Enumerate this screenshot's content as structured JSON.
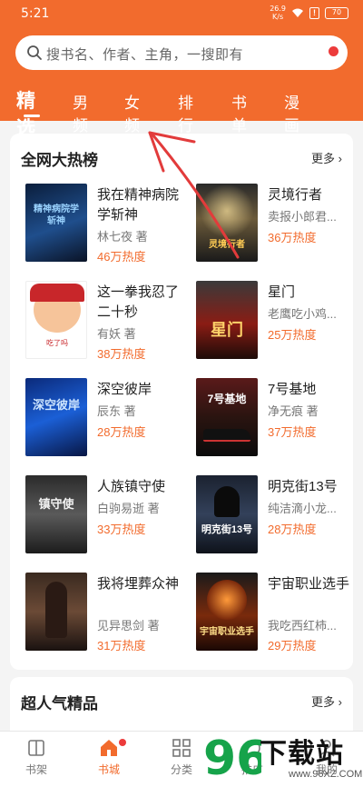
{
  "status_bar": {
    "time": "5:21",
    "net_speed_value": "26.9",
    "net_speed_unit": "K/s",
    "battery": "70"
  },
  "search": {
    "placeholder": "搜书名、作者、主角，一搜即有"
  },
  "tabs": [
    {
      "label": "精选",
      "active": true
    },
    {
      "label": "男频"
    },
    {
      "label": "女频"
    },
    {
      "label": "排行"
    },
    {
      "label": "书单"
    },
    {
      "label": "漫画"
    }
  ],
  "hot_list": {
    "title": "全网大热榜",
    "more": "更多",
    "books": [
      {
        "title": "我在精神病院学斩神",
        "author": "林七夜 著",
        "heat": "46万热度"
      },
      {
        "title": "灵境行者",
        "author": "卖报小郎君...",
        "heat": "36万热度"
      },
      {
        "title": "这一拳我忍了二十秒",
        "author": "有妖 著",
        "heat": "38万热度"
      },
      {
        "title": "星门",
        "author": "老鹰吃小鸡...",
        "heat": "25万热度"
      },
      {
        "title": "深空彼岸",
        "author": "辰东 著",
        "heat": "28万热度"
      },
      {
        "title": "7号基地",
        "author": "净无痕 著",
        "heat": "37万热度"
      },
      {
        "title": "人族镇守使",
        "author": "白驹易逝 著",
        "heat": "33万热度"
      },
      {
        "title": "明克街13号",
        "author": "纯洁滴小龙...",
        "heat": "28万热度"
      },
      {
        "title": "我将埋葬众神",
        "author": "见异思剑 著",
        "heat": "31万热度"
      },
      {
        "title": "宇宙职业选手",
        "author": "我吃西红柿...",
        "heat": "29万热度"
      }
    ],
    "cover_text": [
      "精神病院学斩神",
      "灵境行者",
      "吃了吗",
      "星门",
      "深空彼岸",
      "7号基地",
      "镇守使",
      "明克街13号",
      "",
      "宇宙职业选手"
    ]
  },
  "super_popular": {
    "title": "超人气精品",
    "more": "更多"
  },
  "bottom_nav": [
    {
      "label": "书架",
      "icon": "bookshelf-icon"
    },
    {
      "label": "书城",
      "icon": "home-icon",
      "active": true
    },
    {
      "label": "分类",
      "icon": "category-grid-icon"
    },
    {
      "label": "推广",
      "icon": "promo-icon"
    },
    {
      "label": "我的",
      "icon": "profile-icon"
    }
  ],
  "watermark": {
    "number": "96",
    "text": "下载站",
    "url": "www.96XZ.COM"
  },
  "colors": {
    "accent": "#f26b2d",
    "heat": "#f26b2d",
    "badge": "#ec3b3b",
    "annotation": "#e23b3b"
  }
}
